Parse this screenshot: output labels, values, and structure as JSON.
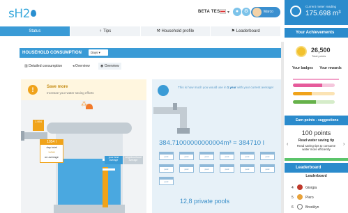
{
  "header": {
    "logo": "sH2",
    "beta_label": "BETA TEST",
    "user_label": "Marco"
  },
  "nav": [
    {
      "label": "Status",
      "icon": "home-icon"
    },
    {
      "label": "Tips",
      "icon": "lightbulb-icon"
    },
    {
      "label": "Household profile",
      "icon": "hammer-icon"
    },
    {
      "label": "Leaderboard",
      "icon": "trophy-icon"
    }
  ],
  "meter": {
    "label": "Current meter reading",
    "value": "175.698 m³"
  },
  "achievements": {
    "title": "Your Achievements",
    "points": "26,500",
    "points_label": "Total points",
    "tab_badges": "Your badges",
    "tab_rewards": "Your rewards"
  },
  "earn_points": {
    "title": "Earn points - suggestions",
    "points": "100 points",
    "tip_title": "Read water saving tip",
    "tip_desc": "Read saving tips to consume water more efficiently"
  },
  "leaderboard": {
    "title": "Leaderboard",
    "subtitle": "Leaderboard",
    "rows": [
      {
        "rank": "4",
        "name": "Giorgia"
      },
      {
        "rank": "5",
        "name": "Piero"
      },
      {
        "rank": "6",
        "name": "Brooklyn"
      }
    ]
  },
  "consumption": {
    "title": "HOUSEHOLD CONSUMPTION",
    "period": "Days",
    "subtabs": [
      "Detailed consumption",
      "Overview",
      "Overview"
    ]
  },
  "save_more": {
    "title": "Save more",
    "desc": "Increase your water saving efforts",
    "tank_reading": "1054 l",
    "tank_sub1": "day total",
    "tank_sub2": "1.04 l",
    "tank_sub3": "on average",
    "legend_best": "your best average",
    "legend_neighbour": "neighbourhood average"
  },
  "yearly": {
    "desc_prefix": "This is how much you would use in ",
    "desc_bold": "1 year",
    "desc_suffix": " with your current average!",
    "total": "384.71000000000004m³ = 384710 l",
    "pool_label": "pool",
    "pools_text": "12,8 private pools"
  },
  "colors": {
    "accent": "#3a9bd6",
    "warning": "#f0a31a",
    "tank": "#4aa8e0"
  }
}
